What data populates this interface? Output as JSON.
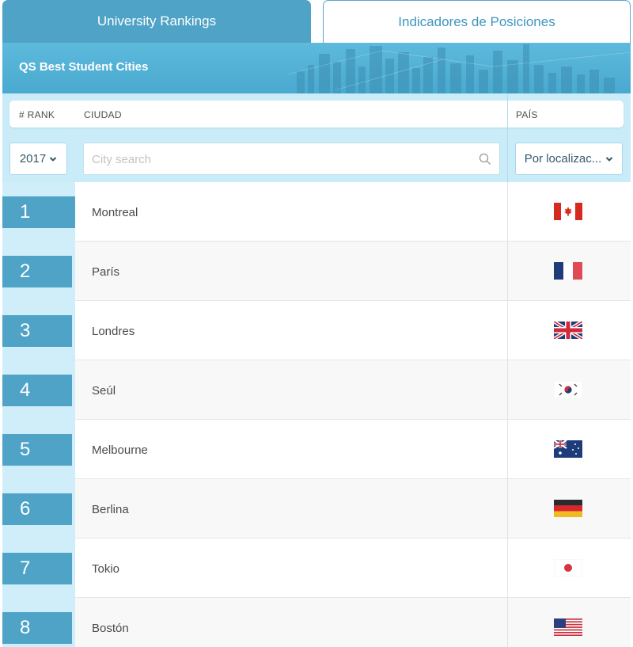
{
  "tabs": [
    {
      "label": "University Rankings",
      "active": true
    },
    {
      "label": "Indicadores de Posiciones",
      "active": false
    }
  ],
  "banner": {
    "title": "QS Best Student Cities"
  },
  "table": {
    "headers": {
      "rank": "# RANK",
      "city": "CIUDAD",
      "country": "PAÍS"
    },
    "filters": {
      "year": "2017",
      "search_placeholder": "City search",
      "location": "Por localizac..."
    },
    "rows": [
      {
        "rank": "1",
        "city": "Montreal",
        "flag": "canada-flag-icon"
      },
      {
        "rank": "2",
        "city": "París",
        "flag": "france-flag-icon"
      },
      {
        "rank": "3",
        "city": "Londres",
        "flag": "uk-flag-icon"
      },
      {
        "rank": "4",
        "city": "Seúl",
        "flag": "south-korea-flag-icon"
      },
      {
        "rank": "5",
        "city": "Melbourne",
        "flag": "australia-flag-icon"
      },
      {
        "rank": "6",
        "city": "Berlina",
        "flag": "germany-flag-icon"
      },
      {
        "rank": "7",
        "city": "Tokio",
        "flag": "japan-flag-icon"
      },
      {
        "rank": "8",
        "city": "Bostón",
        "flag": "usa-flag-icon"
      }
    ]
  },
  "colors": {
    "accent": "#4fa3c6",
    "light_band": "#c9ecf8",
    "strip": "#cfeefa"
  }
}
